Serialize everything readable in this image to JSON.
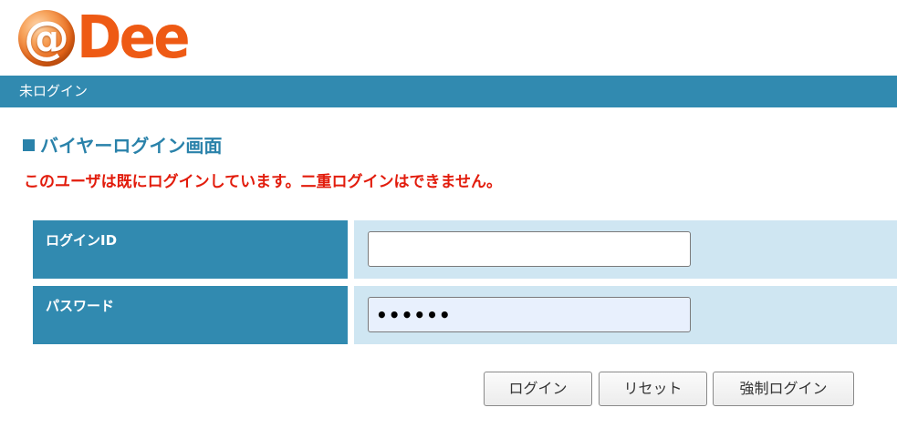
{
  "logo": {
    "at_symbol": "@",
    "brand": "Dee",
    "brand_color": "#ee5a14"
  },
  "status_bar": {
    "text": "未ログイン",
    "color": "#318ab0"
  },
  "page": {
    "title": "バイヤーログイン画面",
    "title_marker": "■",
    "error_message": "このユーザは既にログインしています。二重ログインはできません。",
    "error_color": "#e21c0c"
  },
  "form": {
    "login_id": {
      "label": "ログインID",
      "value": ""
    },
    "password": {
      "label": "パスワード",
      "value": "••••••"
    }
  },
  "buttons": {
    "login": "ログイン",
    "reset": "リセット",
    "force_login": "強制ログイン"
  }
}
